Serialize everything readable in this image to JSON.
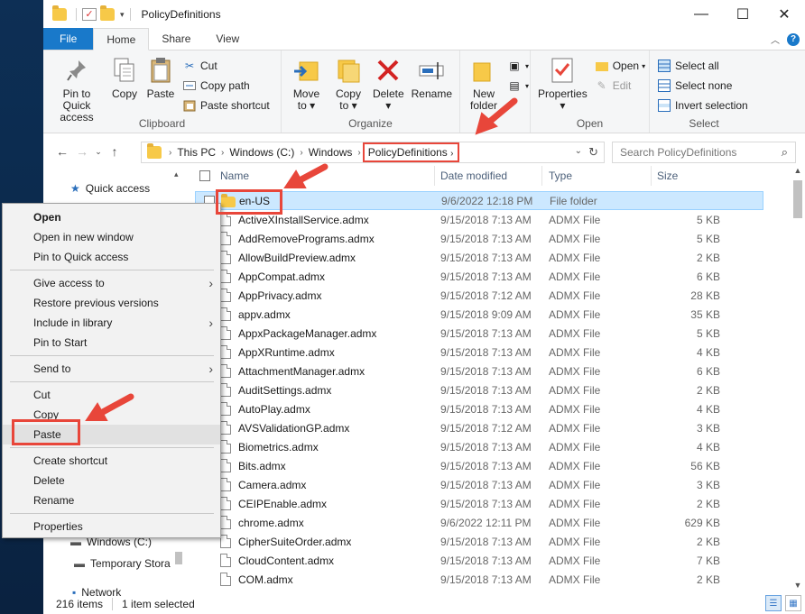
{
  "window": {
    "title": "PolicyDefinitions"
  },
  "tabs": [
    {
      "label": "File"
    },
    {
      "label": "Home"
    },
    {
      "label": "Share"
    },
    {
      "label": "View"
    }
  ],
  "ribbon": {
    "clipboard": {
      "label": "Clipboard",
      "pin": "Pin to Quick access",
      "copy": "Copy",
      "paste": "Paste",
      "cut": "Cut",
      "copy_path": "Copy path",
      "paste_shortcut": "Paste shortcut"
    },
    "organize": {
      "label": "Organize",
      "move_to": "Move to",
      "copy_to": "Copy to",
      "delete": "Delete",
      "rename": "Rename"
    },
    "new": {
      "new_folder": "New folder"
    },
    "open": {
      "label": "Open",
      "properties": "Properties",
      "open": "Open",
      "edit": "Edit"
    },
    "select": {
      "label": "Select",
      "select_all": "Select all",
      "select_none": "Select none",
      "invert": "Invert selection"
    }
  },
  "address": {
    "crumbs": [
      "This PC",
      "Windows (C:)",
      "Windows",
      "PolicyDefinitions"
    ],
    "search_placeholder": "Search PolicyDefinitions"
  },
  "nav": {
    "quick_access": "Quick access",
    "windows_c": "Windows (C:)",
    "temporary": "Temporary Stora",
    "network": "Network"
  },
  "columns": {
    "name": "Name",
    "date": "Date modified",
    "type": "Type",
    "size": "Size"
  },
  "files": [
    {
      "name": "en-US",
      "date": "9/6/2022 12:18 PM",
      "type": "File folder",
      "size": ""
    },
    {
      "name": "ActiveXInstallService.admx",
      "date": "9/15/2018 7:13 AM",
      "type": "ADMX File",
      "size": "5 KB"
    },
    {
      "name": "AddRemovePrograms.admx",
      "date": "9/15/2018 7:13 AM",
      "type": "ADMX File",
      "size": "5 KB"
    },
    {
      "name": "AllowBuildPreview.admx",
      "date": "9/15/2018 7:13 AM",
      "type": "ADMX File",
      "size": "2 KB"
    },
    {
      "name": "AppCompat.admx",
      "date": "9/15/2018 7:13 AM",
      "type": "ADMX File",
      "size": "6 KB"
    },
    {
      "name": "AppPrivacy.admx",
      "date": "9/15/2018 7:12 AM",
      "type": "ADMX File",
      "size": "28 KB"
    },
    {
      "name": "appv.admx",
      "date": "9/15/2018 9:09 AM",
      "type": "ADMX File",
      "size": "35 KB"
    },
    {
      "name": "AppxPackageManager.admx",
      "date": "9/15/2018 7:13 AM",
      "type": "ADMX File",
      "size": "5 KB"
    },
    {
      "name": "AppXRuntime.admx",
      "date": "9/15/2018 7:13 AM",
      "type": "ADMX File",
      "size": "4 KB"
    },
    {
      "name": "AttachmentManager.admx",
      "date": "9/15/2018 7:13 AM",
      "type": "ADMX File",
      "size": "6 KB"
    },
    {
      "name": "AuditSettings.admx",
      "date": "9/15/2018 7:13 AM",
      "type": "ADMX File",
      "size": "2 KB"
    },
    {
      "name": "AutoPlay.admx",
      "date": "9/15/2018 7:13 AM",
      "type": "ADMX File",
      "size": "4 KB"
    },
    {
      "name": "AVSValidationGP.admx",
      "date": "9/15/2018 7:12 AM",
      "type": "ADMX File",
      "size": "3 KB"
    },
    {
      "name": "Biometrics.admx",
      "date": "9/15/2018 7:13 AM",
      "type": "ADMX File",
      "size": "4 KB"
    },
    {
      "name": "Bits.admx",
      "date": "9/15/2018 7:13 AM",
      "type": "ADMX File",
      "size": "56 KB"
    },
    {
      "name": "Camera.admx",
      "date": "9/15/2018 7:13 AM",
      "type": "ADMX File",
      "size": "3 KB"
    },
    {
      "name": "CEIPEnable.admx",
      "date": "9/15/2018 7:13 AM",
      "type": "ADMX File",
      "size": "2 KB"
    },
    {
      "name": "chrome.admx",
      "date": "9/6/2022 12:11 PM",
      "type": "ADMX File",
      "size": "629 KB"
    },
    {
      "name": "CipherSuiteOrder.admx",
      "date": "9/15/2018 7:13 AM",
      "type": "ADMX File",
      "size": "2 KB"
    },
    {
      "name": "CloudContent.admx",
      "date": "9/15/2018 7:13 AM",
      "type": "ADMX File",
      "size": "7 KB"
    },
    {
      "name": "COM.admx",
      "date": "9/15/2018 7:13 AM",
      "type": "ADMX File",
      "size": "2 KB"
    }
  ],
  "context_menu": {
    "open": "Open",
    "open_new_window": "Open in new window",
    "pin_quick": "Pin to Quick access",
    "give_access": "Give access to",
    "restore": "Restore previous versions",
    "include_library": "Include in library",
    "pin_start": "Pin to Start",
    "send_to": "Send to",
    "cut": "Cut",
    "copy": "Copy",
    "paste": "Paste",
    "create_shortcut": "Create shortcut",
    "delete": "Delete",
    "rename": "Rename",
    "properties": "Properties"
  },
  "status": {
    "items": "216 items",
    "selected": "1 item selected"
  },
  "colors": {
    "accent": "#1979ca",
    "highlight": "#e8463a",
    "selection": "#cce8ff"
  },
  "icons": [
    "folder-icon",
    "checkmark-icon",
    "pin-icon",
    "copy-icon",
    "paste-icon",
    "scissors-icon",
    "delete-icon",
    "rename-icon",
    "properties-icon",
    "search-icon",
    "star-icon",
    "drive-icon"
  ]
}
